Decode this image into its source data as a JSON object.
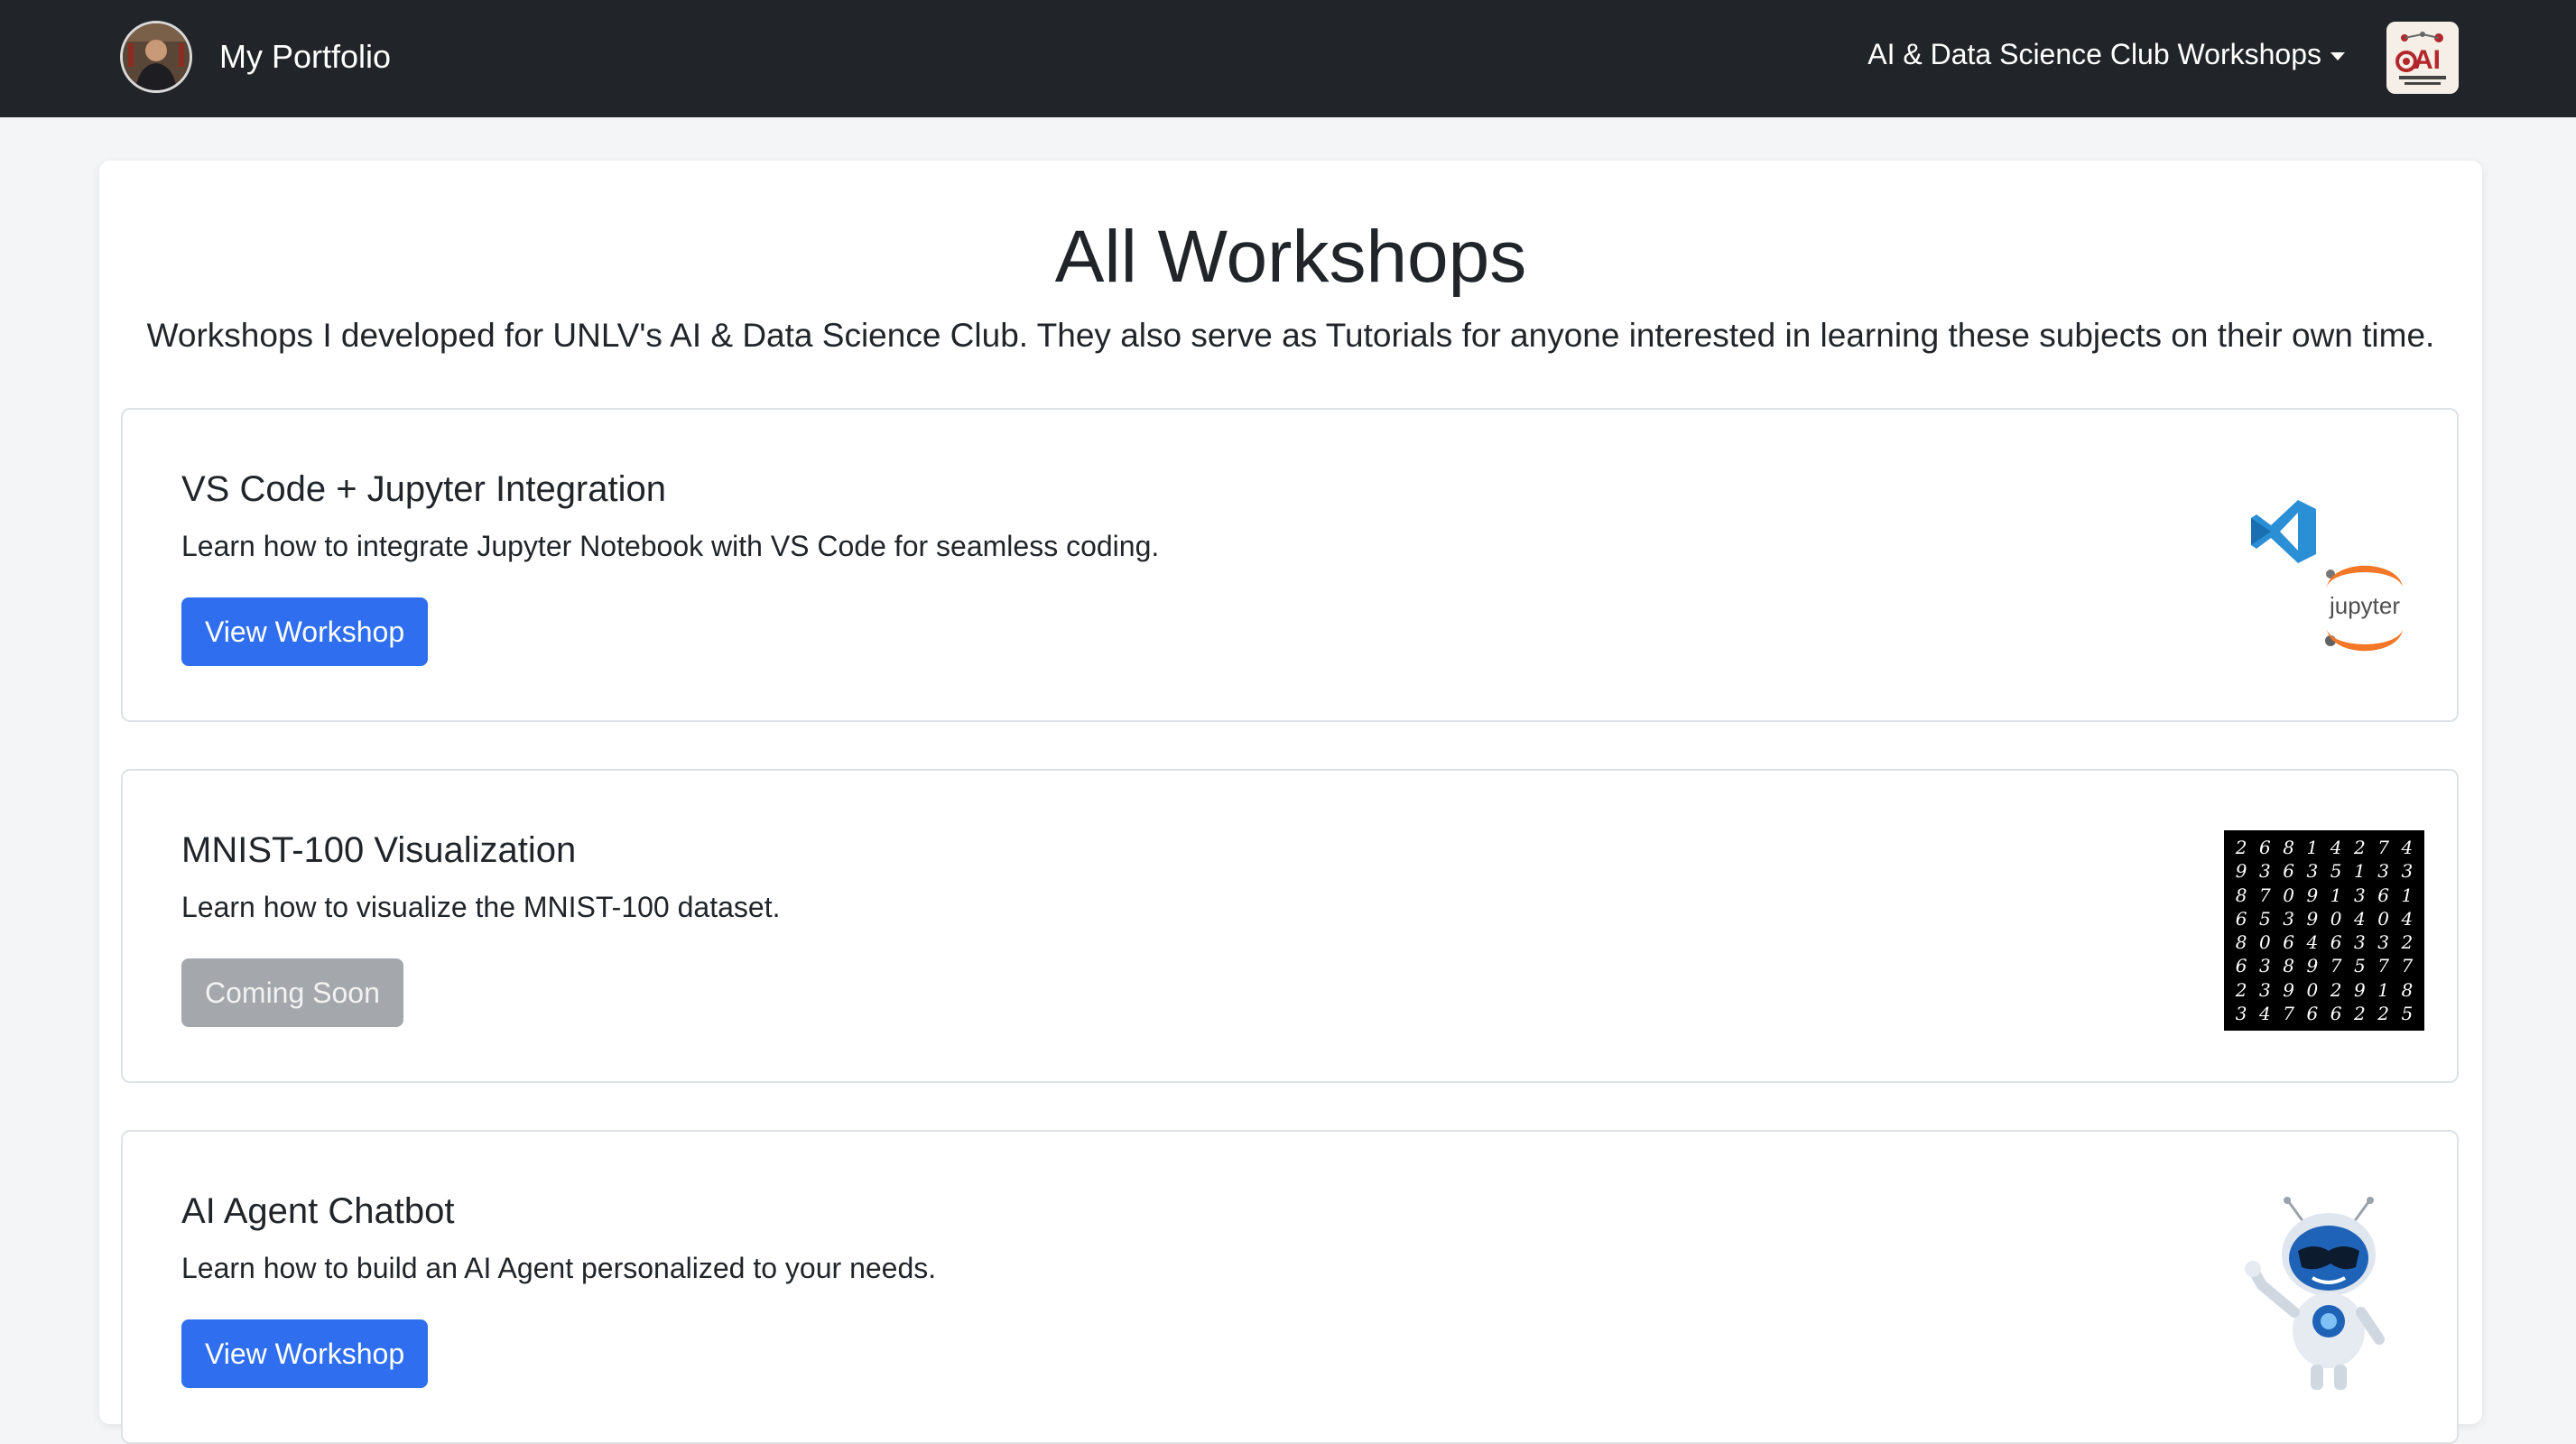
{
  "navbar": {
    "brand": "My Portfolio",
    "dropdown_label": "AI & Data Science Club Workshops",
    "club_logo_text": "AI"
  },
  "page": {
    "title": "All Workshops",
    "subtitle": "Workshops I developed for UNLV's AI & Data Science Club. They also serve as Tutorials for anyone interested in learning these subjects on their own time."
  },
  "workshops": [
    {
      "title": "VS Code + Jupyter Integration",
      "description": "Learn how to integrate Jupyter Notebook with VS Code for seamless coding.",
      "button": "View Workshop",
      "logo_text": "jupyter"
    },
    {
      "title": "MNIST-100 Visualization",
      "description": "Learn how to visualize the MNIST-100 dataset.",
      "button": "Coming Soon",
      "digits": [
        "2",
        "6",
        "8",
        "1",
        "4",
        "2",
        "7",
        "4",
        "9",
        "3",
        "6",
        "3",
        "5",
        "1",
        "3",
        "3",
        "8",
        "7",
        "0",
        "9",
        "1",
        "3",
        "6",
        "1",
        "6",
        "5",
        "3",
        "9",
        "0",
        "4",
        "0",
        "4",
        "8",
        "0",
        "6",
        "4",
        "6",
        "3",
        "3",
        "2",
        "6",
        "3",
        "8",
        "9",
        "7",
        "5",
        "7",
        "7",
        "2",
        "3",
        "9",
        "0",
        "2",
        "9",
        "1",
        "8",
        "3",
        "4",
        "7",
        "6",
        "6",
        "2",
        "2",
        "5"
      ]
    },
    {
      "title": "AI Agent Chatbot",
      "description": "Learn how to build an AI Agent personalized to your needs.",
      "button": "View Workshop"
    }
  ],
  "colors": {
    "navbar": "#212529",
    "primary_button": "#2f6fef",
    "disabled_button": "#a4a7ab",
    "vscode_blue": "#2b8fd6",
    "jupyter_orange": "#f37726"
  }
}
